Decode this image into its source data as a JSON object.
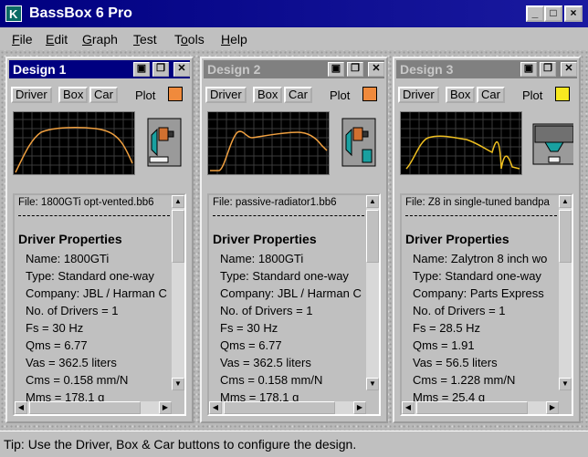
{
  "app": {
    "title": "BassBox 6 Pro",
    "icon_glyph": "K",
    "minimize": "_",
    "maximize": "□",
    "close": "×"
  },
  "menu": [
    {
      "label": "File",
      "key": "F",
      "rest": "ile"
    },
    {
      "label": "Edit",
      "key": "E",
      "rest": "dit"
    },
    {
      "label": "Graph",
      "key": "G",
      "rest": "raph"
    },
    {
      "label": "Test",
      "key": "T",
      "rest": "est"
    },
    {
      "label": "Tools",
      "key": "o",
      "pre": "T",
      "rest": "ols"
    },
    {
      "label": "Help",
      "key": "H",
      "rest": "elp"
    }
  ],
  "designs": [
    {
      "title": "Design 1",
      "active": true,
      "buttons": {
        "driver": "Driver",
        "box": "Box",
        "car": "Car",
        "plot": "Plot"
      },
      "plot_color": "#f08a3c",
      "curve_color": "#f0a040",
      "box_type": "vented",
      "file": "File: 1800GTi opt-vented.bb6",
      "heading": "Driver Properties",
      "properties": [
        "Name: 1800GTi",
        "Type: Standard one-way",
        "Company: JBL / Harman C",
        "No. of Drivers = 1",
        "Fs =  30 Hz",
        "Qms =  6.77",
        "Vas =  362.5 liters",
        "Cms =  0.158 mm/N",
        "Mms =  178.1 g"
      ]
    },
    {
      "title": "Design 2",
      "active": false,
      "buttons": {
        "driver": "Driver",
        "box": "Box",
        "car": "Car",
        "plot": "Plot"
      },
      "plot_color": "#f08a3c",
      "curve_color": "#f0a040",
      "box_type": "passive-radiator",
      "file": "File: passive-radiator1.bb6",
      "heading": "Driver Properties",
      "properties": [
        "Name: 1800GTi",
        "Type: Standard one-way",
        "Company: JBL / Harman C",
        "No. of Drivers = 1",
        "Fs =  30 Hz",
        "Qms =  6.77",
        "Vas =  362.5 liters",
        "Cms =  0.158 mm/N",
        "Mms =  178.1 g"
      ]
    },
    {
      "title": "Design 3",
      "active": false,
      "buttons": {
        "driver": "Driver",
        "box": "Box",
        "car": "Car",
        "plot": "Plot"
      },
      "plot_color": "#f8e820",
      "curve_color": "#f0c020",
      "box_type": "bandpass",
      "file": "File: Z8 in single-tuned bandpa",
      "heading": "Driver Properties",
      "properties": [
        "Name: Zalytron 8 inch wo",
        "Type: Standard one-way",
        "Company: Parts Express",
        "No. of Drivers = 1",
        "Fs =  28.5 Hz",
        "Qms =  1.91",
        "Vas =  56.5 liters",
        "Cms =  1.228 mm/N",
        "Mms =  25.4 g"
      ]
    }
  ],
  "status": {
    "tip": "Tip: Use the Driver, Box & Car buttons to configure the design."
  }
}
